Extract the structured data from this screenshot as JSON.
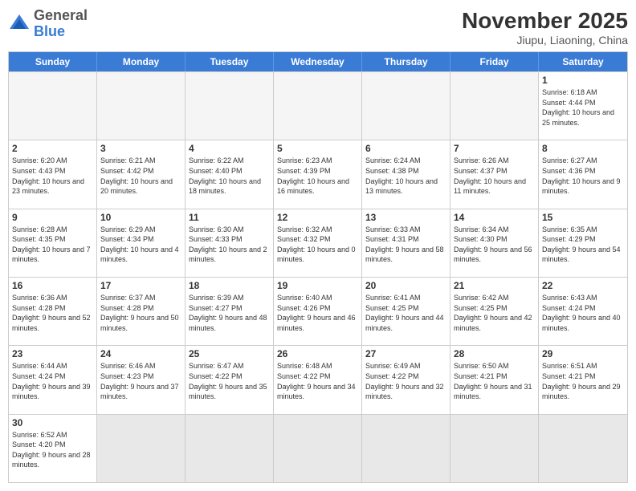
{
  "header": {
    "logo_general": "General",
    "logo_blue": "Blue",
    "title": "November 2025",
    "subtitle": "Jiupu, Liaoning, China"
  },
  "calendar": {
    "days_of_week": [
      "Sunday",
      "Monday",
      "Tuesday",
      "Wednesday",
      "Thursday",
      "Friday",
      "Saturday"
    ],
    "weeks": [
      [
        {
          "day": "",
          "empty": true
        },
        {
          "day": "",
          "empty": true
        },
        {
          "day": "",
          "empty": true
        },
        {
          "day": "",
          "empty": true
        },
        {
          "day": "",
          "empty": true
        },
        {
          "day": "",
          "empty": true
        },
        {
          "day": "1",
          "sunrise": "6:18 AM",
          "sunset": "4:44 PM",
          "daylight": "10 hours and 25 minutes."
        }
      ],
      [
        {
          "day": "2",
          "sunrise": "6:20 AM",
          "sunset": "4:43 PM",
          "daylight": "10 hours and 23 minutes."
        },
        {
          "day": "3",
          "sunrise": "6:21 AM",
          "sunset": "4:42 PM",
          "daylight": "10 hours and 20 minutes."
        },
        {
          "day": "4",
          "sunrise": "6:22 AM",
          "sunset": "4:40 PM",
          "daylight": "10 hours and 18 minutes."
        },
        {
          "day": "5",
          "sunrise": "6:23 AM",
          "sunset": "4:39 PM",
          "daylight": "10 hours and 16 minutes."
        },
        {
          "day": "6",
          "sunrise": "6:24 AM",
          "sunset": "4:38 PM",
          "daylight": "10 hours and 13 minutes."
        },
        {
          "day": "7",
          "sunrise": "6:26 AM",
          "sunset": "4:37 PM",
          "daylight": "10 hours and 11 minutes."
        },
        {
          "day": "8",
          "sunrise": "6:27 AM",
          "sunset": "4:36 PM",
          "daylight": "10 hours and 9 minutes."
        }
      ],
      [
        {
          "day": "9",
          "sunrise": "6:28 AM",
          "sunset": "4:35 PM",
          "daylight": "10 hours and 7 minutes."
        },
        {
          "day": "10",
          "sunrise": "6:29 AM",
          "sunset": "4:34 PM",
          "daylight": "10 hours and 4 minutes."
        },
        {
          "day": "11",
          "sunrise": "6:30 AM",
          "sunset": "4:33 PM",
          "daylight": "10 hours and 2 minutes."
        },
        {
          "day": "12",
          "sunrise": "6:32 AM",
          "sunset": "4:32 PM",
          "daylight": "10 hours and 0 minutes."
        },
        {
          "day": "13",
          "sunrise": "6:33 AM",
          "sunset": "4:31 PM",
          "daylight": "9 hours and 58 minutes."
        },
        {
          "day": "14",
          "sunrise": "6:34 AM",
          "sunset": "4:30 PM",
          "daylight": "9 hours and 56 minutes."
        },
        {
          "day": "15",
          "sunrise": "6:35 AM",
          "sunset": "4:29 PM",
          "daylight": "9 hours and 54 minutes."
        }
      ],
      [
        {
          "day": "16",
          "sunrise": "6:36 AM",
          "sunset": "4:28 PM",
          "daylight": "9 hours and 52 minutes."
        },
        {
          "day": "17",
          "sunrise": "6:37 AM",
          "sunset": "4:28 PM",
          "daylight": "9 hours and 50 minutes."
        },
        {
          "day": "18",
          "sunrise": "6:39 AM",
          "sunset": "4:27 PM",
          "daylight": "9 hours and 48 minutes."
        },
        {
          "day": "19",
          "sunrise": "6:40 AM",
          "sunset": "4:26 PM",
          "daylight": "9 hours and 46 minutes."
        },
        {
          "day": "20",
          "sunrise": "6:41 AM",
          "sunset": "4:25 PM",
          "daylight": "9 hours and 44 minutes."
        },
        {
          "day": "21",
          "sunrise": "6:42 AM",
          "sunset": "4:25 PM",
          "daylight": "9 hours and 42 minutes."
        },
        {
          "day": "22",
          "sunrise": "6:43 AM",
          "sunset": "4:24 PM",
          "daylight": "9 hours and 40 minutes."
        }
      ],
      [
        {
          "day": "23",
          "sunrise": "6:44 AM",
          "sunset": "4:24 PM",
          "daylight": "9 hours and 39 minutes."
        },
        {
          "day": "24",
          "sunrise": "6:46 AM",
          "sunset": "4:23 PM",
          "daylight": "9 hours and 37 minutes."
        },
        {
          "day": "25",
          "sunrise": "6:47 AM",
          "sunset": "4:22 PM",
          "daylight": "9 hours and 35 minutes."
        },
        {
          "day": "26",
          "sunrise": "6:48 AM",
          "sunset": "4:22 PM",
          "daylight": "9 hours and 34 minutes."
        },
        {
          "day": "27",
          "sunrise": "6:49 AM",
          "sunset": "4:22 PM",
          "daylight": "9 hours and 32 minutes."
        },
        {
          "day": "28",
          "sunrise": "6:50 AM",
          "sunset": "4:21 PM",
          "daylight": "9 hours and 31 minutes."
        },
        {
          "day": "29",
          "sunrise": "6:51 AM",
          "sunset": "4:21 PM",
          "daylight": "9 hours and 29 minutes."
        }
      ],
      [
        {
          "day": "30",
          "sunrise": "6:52 AM",
          "sunset": "4:20 PM",
          "daylight": "9 hours and 28 minutes."
        },
        {
          "day": "",
          "empty": true,
          "last": true
        },
        {
          "day": "",
          "empty": true,
          "last": true
        },
        {
          "day": "",
          "empty": true,
          "last": true
        },
        {
          "day": "",
          "empty": true,
          "last": true
        },
        {
          "day": "",
          "empty": true,
          "last": true
        },
        {
          "day": "",
          "empty": true,
          "last": true
        }
      ]
    ]
  }
}
